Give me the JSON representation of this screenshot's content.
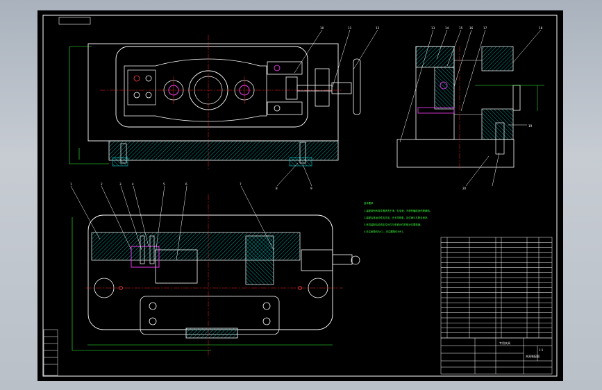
{
  "drawing": {
    "background": "#000000",
    "line_color": "#ffffff",
    "hatch_color": "#00cccc",
    "center_line_color": "#ff2020",
    "dimension_color": "#30ff30",
    "part_color": "#ff40ff"
  },
  "tech_notes": {
    "heading": "技术要求",
    "lines": [
      "1.装配前所有零件需清洗干净，去毛刺，不得有磕碰划伤等缺陷。",
      "2.装配后各运动件应灵活，无卡滞现象，定位销与孔配合良好。",
      "3.夹具装配后检查定位元件与夹紧元件的相对位置精度。",
      "4.未注倒角均为C1，未注圆角均为R1。"
    ]
  },
  "title_block": {
    "name": "专用夹具",
    "drawing_title": "夹具装配图",
    "sheet": "1:1"
  },
  "part_labels": [
    "1",
    "2",
    "3",
    "4",
    "5",
    "6",
    "7",
    "8",
    "9",
    "10",
    "11",
    "12",
    "13",
    "14",
    "15",
    "16",
    "17",
    "18",
    "19",
    "20"
  ]
}
